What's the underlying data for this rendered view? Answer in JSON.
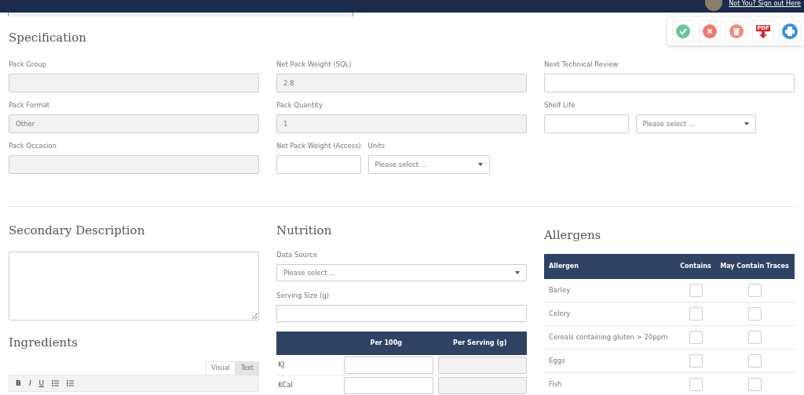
{
  "header": {
    "user_text": "Not You? Sign out Here"
  },
  "actions": [
    {
      "kind": "approve"
    },
    {
      "kind": "cancel"
    },
    {
      "kind": "delete"
    },
    {
      "kind": "pdf",
      "glyph": "PDF"
    },
    {
      "kind": "print"
    }
  ],
  "specification": {
    "title": "Specification",
    "columns": [
      [
        [
          {
            "label": "Pack Group",
            "kind": "text",
            "disabled": true
          }
        ],
        [
          {
            "label": "Pack Format",
            "kind": "text",
            "value": "Other",
            "disabled": true
          }
        ],
        [
          {
            "label": "Pack Occasion",
            "kind": "text",
            "disabled": true
          }
        ]
      ],
      [
        [
          {
            "label": "Net Pack Weight (SQL)",
            "kind": "text",
            "value": "2.8",
            "disabled": true
          }
        ],
        [
          {
            "label": "Pack Quantity",
            "kind": "text",
            "value": "1",
            "disabled": true
          }
        ],
        [
          {
            "label": "Net Pack Weight (Access)",
            "kind": "text",
            "disabled": false
          },
          {
            "label": "Units",
            "kind": "select",
            "value": "Please select ...",
            "disabled": false
          }
        ]
      ],
      [
        [
          {
            "label": "Next Technical Review",
            "kind": "text",
            "disabled": false
          }
        ],
        [
          {
            "label": "Shelf Life",
            "kind": "text",
            "disabled": false
          },
          {
            "kind": "select",
            "value": "Please select ...",
            "disabled": false
          }
        ]
      ]
    ]
  },
  "secondary_description": {
    "title": "Secondary Description"
  },
  "ingredients": {
    "title": "Ingredients",
    "editor_tabs": [
      {
        "label": "Visual",
        "selected": true
      },
      {
        "label": "Text",
        "selected": false
      }
    ],
    "tools": [
      {
        "kind": "bold",
        "glyph": "B"
      },
      {
        "kind": "italic",
        "glyph": "I"
      },
      {
        "kind": "underline",
        "glyph": "U"
      },
      {
        "kind": "bullets"
      },
      {
        "kind": "numbers"
      }
    ]
  },
  "nutrition": {
    "title": "Nutrition",
    "fields": [
      {
        "label": "Data Source",
        "kind": "select",
        "value": "Please select ...",
        "disabled": false
      },
      {
        "label": "Serving Size (g)",
        "kind": "text",
        "disabled": false
      }
    ],
    "columns": [
      "Per 100g",
      "Per Serving (g)"
    ],
    "rows": [
      {
        "name": "KJ",
        "cells": [
          {
            "disabled": false
          },
          {
            "disabled": true
          }
        ]
      },
      {
        "name": "KCal",
        "cells": [
          {
            "disabled": false
          },
          {
            "disabled": true
          }
        ]
      }
    ]
  },
  "allergens": {
    "title": "Allergens",
    "columns": [
      "Allergen",
      "Contains",
      "May Contain Traces"
    ],
    "rows": [
      {
        "name": "Barley",
        "contains": false,
        "traces": false
      },
      {
        "name": "Celery",
        "contains": false,
        "traces": false
      },
      {
        "name": "Cereals containing gluten > 20ppm",
        "contains": false,
        "traces": false
      },
      {
        "name": "Eggs",
        "contains": false,
        "traces": false
      },
      {
        "name": "Fish",
        "contains": false,
        "traces": false
      }
    ]
  }
}
